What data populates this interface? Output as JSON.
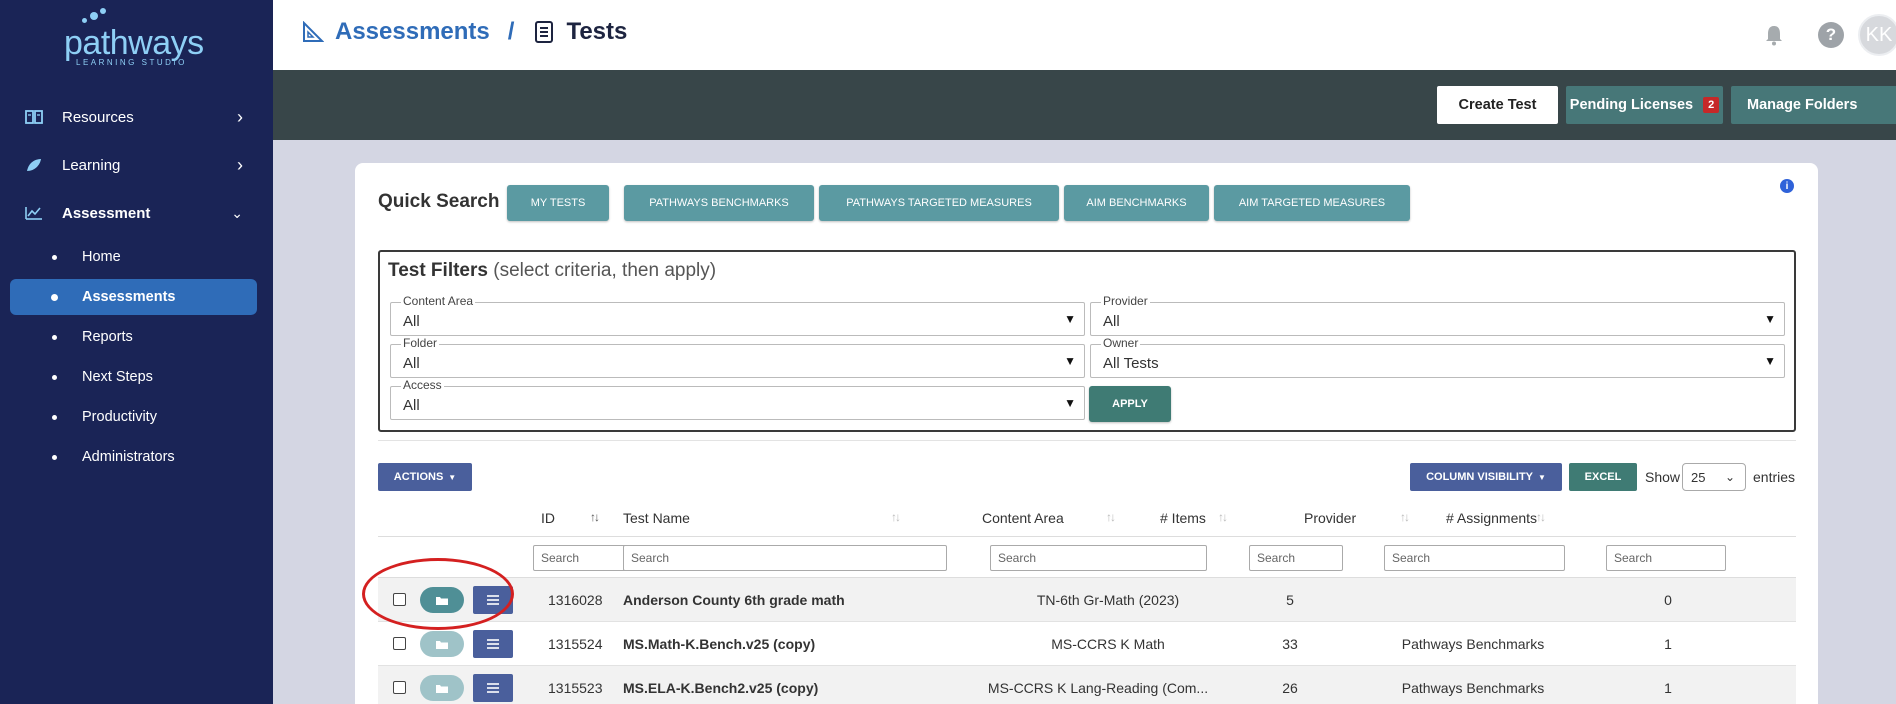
{
  "brand": {
    "name": "pathways",
    "tagline": "LEARNING STUDIO"
  },
  "sidebar": {
    "items": [
      {
        "label": "Resources",
        "icon": "book-icon"
      },
      {
        "label": "Learning",
        "icon": "leaf-icon"
      },
      {
        "label": "Assessment",
        "icon": "chart-icon"
      }
    ],
    "subitems": [
      {
        "label": "Home"
      },
      {
        "label": "Assessments"
      },
      {
        "label": "Reports"
      },
      {
        "label": "Next Steps"
      },
      {
        "label": "Productivity"
      },
      {
        "label": "Administrators"
      }
    ]
  },
  "header": {
    "crumb1": "Assessments",
    "sep": "/",
    "crumb2": "Tests",
    "avatar": "KK",
    "help": "?"
  },
  "actionbar": {
    "create": "Create Test",
    "pending": "Pending Licenses",
    "pending_count": "2",
    "folders": "Manage Folders"
  },
  "quick_search": {
    "label": "Quick Search",
    "buttons": [
      "MY TESTS",
      "PATHWAYS BENCHMARKS",
      "PATHWAYS TARGETED MEASURES",
      "AIM BENCHMARKS",
      "AIM TARGETED MEASURES"
    ],
    "info": "i"
  },
  "filters": {
    "title": "Test Filters",
    "subtitle": "(select criteria, then apply)",
    "content_area": {
      "label": "Content Area",
      "value": "All"
    },
    "provider": {
      "label": "Provider",
      "value": "All"
    },
    "folder": {
      "label": "Folder",
      "value": "All"
    },
    "owner": {
      "label": "Owner",
      "value": "All Tests"
    },
    "access": {
      "label": "Access",
      "value": "All"
    },
    "apply": "APPLY"
  },
  "table_controls": {
    "actions": "ACTIONS",
    "column_visibility": "COLUMN VISIBILITY",
    "excel": "EXCEL",
    "show": "Show",
    "page_size": "25",
    "entries": "entries"
  },
  "table": {
    "columns": [
      "ID",
      "Test Name",
      "Content Area",
      "# Items",
      "Provider",
      "# Assignments"
    ],
    "search_placeholder": "Search",
    "rows": [
      {
        "id": "1316028",
        "name": "Anderson County 6th grade math",
        "content_area": "TN-6th Gr-Math (2023)",
        "items": "5",
        "provider": "",
        "assignments": "0"
      },
      {
        "id": "1315524",
        "name": "MS.Math-K.Bench.v25 (copy)",
        "content_area": "MS-CCRS K Math",
        "items": "33",
        "provider": "Pathways Benchmarks",
        "assignments": "1"
      },
      {
        "id": "1315523",
        "name": "MS.ELA-K.Bench2.v25 (copy)",
        "content_area": "MS-CCRS K Lang-Reading (Com...",
        "items": "26",
        "provider": "Pathways Benchmarks",
        "assignments": "1"
      }
    ]
  },
  "colors": {
    "sidebar_bg": "#1a2456",
    "active_nav": "#2f6cb8",
    "teal_btn": "#5b9aa2",
    "primary_btn": "#4a5f9c",
    "annotation_red": "#d42020"
  }
}
